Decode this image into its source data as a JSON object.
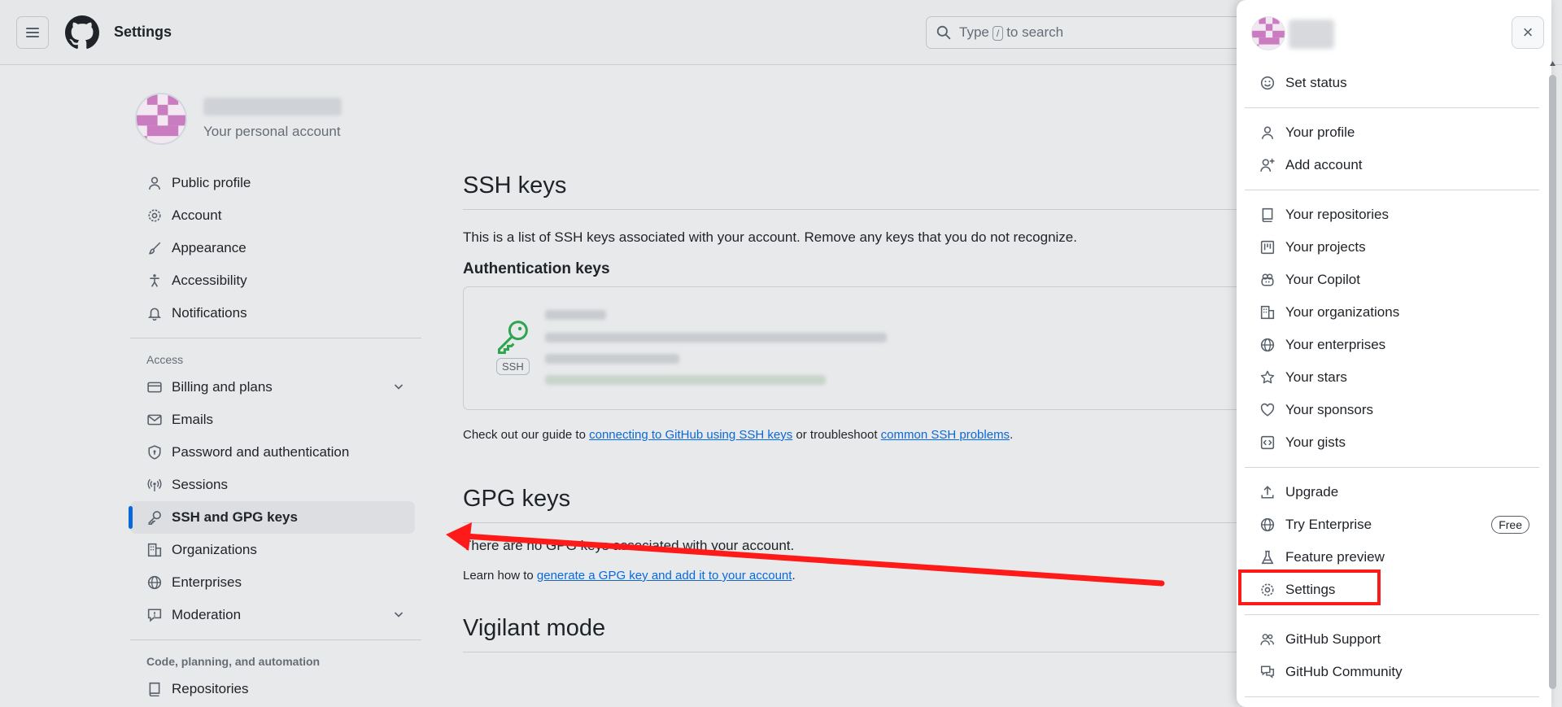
{
  "header": {
    "title": "Settings",
    "search_text": "Type / to search",
    "search_prefix": "Type",
    "search_key": "/",
    "search_suffix": "to search"
  },
  "account": {
    "subtitle": "Your personal account"
  },
  "sidebar": {
    "items_top": [
      {
        "label": "Public profile",
        "icon": "person-icon"
      },
      {
        "label": "Account",
        "icon": "gear-icon"
      },
      {
        "label": "Appearance",
        "icon": "paintbrush-icon"
      },
      {
        "label": "Accessibility",
        "icon": "accessibility-icon"
      },
      {
        "label": "Notifications",
        "icon": "bell-icon"
      }
    ],
    "access_heading": "Access",
    "items_access": [
      {
        "label": "Billing and plans",
        "icon": "credit-card-icon"
      },
      {
        "label": "Emails",
        "icon": "mail-icon"
      },
      {
        "label": "Password and authentication",
        "icon": "shield-icon"
      },
      {
        "label": "Sessions",
        "icon": "broadcast-icon"
      },
      {
        "label": "SSH and GPG keys",
        "icon": "key-icon"
      },
      {
        "label": "Organizations",
        "icon": "organization-icon"
      },
      {
        "label": "Enterprises",
        "icon": "globe-icon"
      },
      {
        "label": "Moderation",
        "icon": "report-icon"
      }
    ],
    "code_heading": "Code, planning, and automation",
    "items_code": [
      {
        "label": "Repositories",
        "icon": "repo-icon"
      }
    ]
  },
  "main": {
    "ssh_title": "SSH keys",
    "ssh_desc": "This is a list of SSH keys associated with your account. Remove any keys that you do not recognize.",
    "auth_keys_heading": "Authentication keys",
    "ssh_badge": "SSH",
    "guide_prefix": "Check out our guide to",
    "guide_link1": "connecting to GitHub using SSH keys",
    "guide_middle": "or troubleshoot",
    "guide_link2": "common SSH problems",
    "guide_suffix": ".",
    "gpg_title": "GPG keys",
    "gpg_desc": "There are no GPG keys associated with your account.",
    "gpg_learn_prefix": "Learn how to",
    "gpg_learn_link": "generate a GPG key and add it to your account",
    "gpg_learn_suffix": ".",
    "vigilant_title": "Vigilant mode"
  },
  "panel": {
    "close_label": "×",
    "group1": [
      {
        "label": "Set status",
        "icon": "smiley-icon"
      }
    ],
    "group2": [
      {
        "label": "Your profile",
        "icon": "person-icon"
      },
      {
        "label": "Add account",
        "icon": "person-add-icon"
      }
    ],
    "group3": [
      {
        "label": "Your repositories",
        "icon": "repo-icon"
      },
      {
        "label": "Your projects",
        "icon": "project-icon"
      },
      {
        "label": "Your Copilot",
        "icon": "copilot-icon"
      },
      {
        "label": "Your organizations",
        "icon": "organization-icon"
      },
      {
        "label": "Your enterprises",
        "icon": "globe-icon"
      },
      {
        "label": "Your stars",
        "icon": "star-icon"
      },
      {
        "label": "Your sponsors",
        "icon": "heart-icon"
      },
      {
        "label": "Your gists",
        "icon": "code-square-icon"
      }
    ],
    "group4": [
      {
        "label": "Upgrade",
        "icon": "upload-icon"
      },
      {
        "label": "Try Enterprise",
        "icon": "globe-icon",
        "badge": "Free"
      },
      {
        "label": "Feature preview",
        "icon": "beaker-icon"
      },
      {
        "label": "Settings",
        "icon": "gear-icon"
      }
    ],
    "group5": [
      {
        "label": "GitHub Support",
        "icon": "people-icon"
      },
      {
        "label": "GitHub Community",
        "icon": "comment-discussion-icon"
      }
    ]
  },
  "annotation_color": "#ff1a1a",
  "accent_color": "#0969da"
}
